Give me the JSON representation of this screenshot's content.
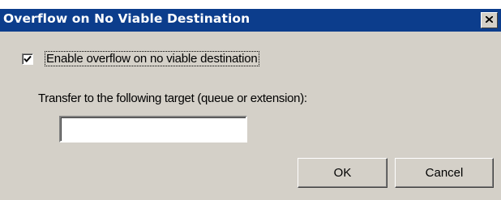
{
  "dialog": {
    "title": "Overflow on No Viable Destination",
    "close_icon": "close-icon",
    "colors": {
      "titlebar": "#0c3d8c",
      "face": "#d4d0c8"
    }
  },
  "overflow_checkbox": {
    "label": "Enable overflow on no viable destination",
    "checked": true
  },
  "transfer": {
    "label": "Transfer to the following target (queue or extension):",
    "value": "",
    "placeholder": ""
  },
  "buttons": {
    "ok_label": "OK",
    "cancel_label": "Cancel"
  }
}
